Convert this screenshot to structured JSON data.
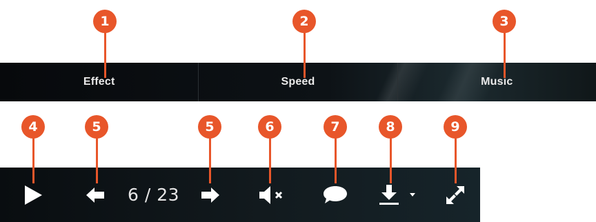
{
  "tabs": [
    {
      "label": "Effect"
    },
    {
      "label": "Speed"
    },
    {
      "label": "Music"
    }
  ],
  "callouts": {
    "effect": "1",
    "speed": "2",
    "music": "3",
    "play": "4",
    "prev": "5",
    "next": "5",
    "mute": "6",
    "comment": "7",
    "download": "8",
    "fullscreen": "9"
  },
  "player": {
    "page_counter": "6 / 23"
  },
  "icons": {
    "play": "play-icon",
    "prev": "arrow-left-icon",
    "next": "arrow-right-icon",
    "mute": "volume-muted-icon",
    "comment": "speech-bubble-icon",
    "download": "download-icon",
    "download_menu": "caret-down-icon",
    "fullscreen": "expand-icon"
  },
  "colors": {
    "callout": "#e8562a",
    "bar": "#0d1317",
    "icon": "#ffffff"
  }
}
